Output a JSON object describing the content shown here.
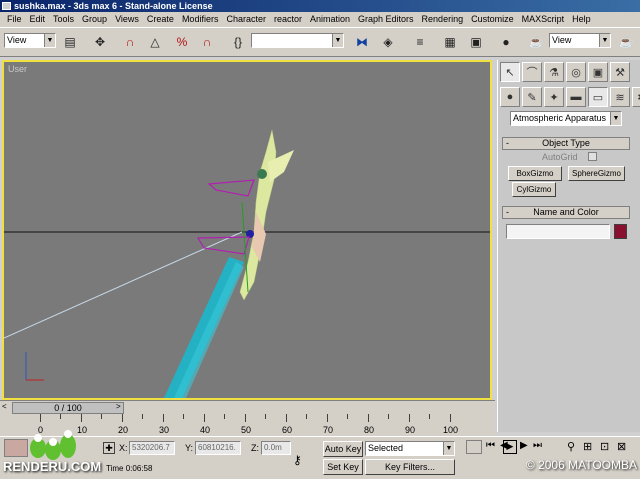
{
  "window": {
    "title": "sushka.max - 3ds max 6 - Stand-alone License"
  },
  "menu": [
    "File",
    "Edit",
    "Tools",
    "Group",
    "Views",
    "Create",
    "Modifiers",
    "Character",
    "reactor",
    "Animation",
    "Graph Editors",
    "Rendering",
    "Customize",
    "MAXScript",
    "Help"
  ],
  "toolbar": {
    "selection_filter": "View",
    "named_selection": "",
    "coord_system": "View"
  },
  "viewport": {
    "label": "User"
  },
  "command_panel": {
    "category_dropdown": "Atmospheric Apparatus",
    "object_type": {
      "title": "Object Type",
      "autogrid_label": "AutoGrid",
      "buttons": [
        "BoxGizmo",
        "SphereGizmo",
        "CylGizmo"
      ]
    },
    "name_color": {
      "title": "Name and Color",
      "name_value": "",
      "swatch_color": "#8a1030"
    }
  },
  "timeline": {
    "slider_text": "0 / 100",
    "ruler_numbers": [
      "0",
      "10",
      "20",
      "30",
      "40",
      "50",
      "60",
      "70",
      "80",
      "90",
      "100"
    ]
  },
  "status": {
    "x_label": "X:",
    "x_value": "5320206.7",
    "y_label": "Y:",
    "y_value": "60810216.",
    "z_label": "Z:",
    "z_value": "0.0m",
    "auto_key": "Auto Key",
    "set_key": "Set Key",
    "selected": "Selected",
    "key_filters": "Key Filters...",
    "render_time": "Time 0:06:58"
  },
  "watermarks": {
    "left": "RENDERU.COM",
    "right": "© 2006 MATOOMBA"
  },
  "colors": {
    "viewport_bg": "#7a7a7a",
    "viewport_border": "#f0e040",
    "beam": "#20b4c8",
    "model": "#dce8a0"
  }
}
